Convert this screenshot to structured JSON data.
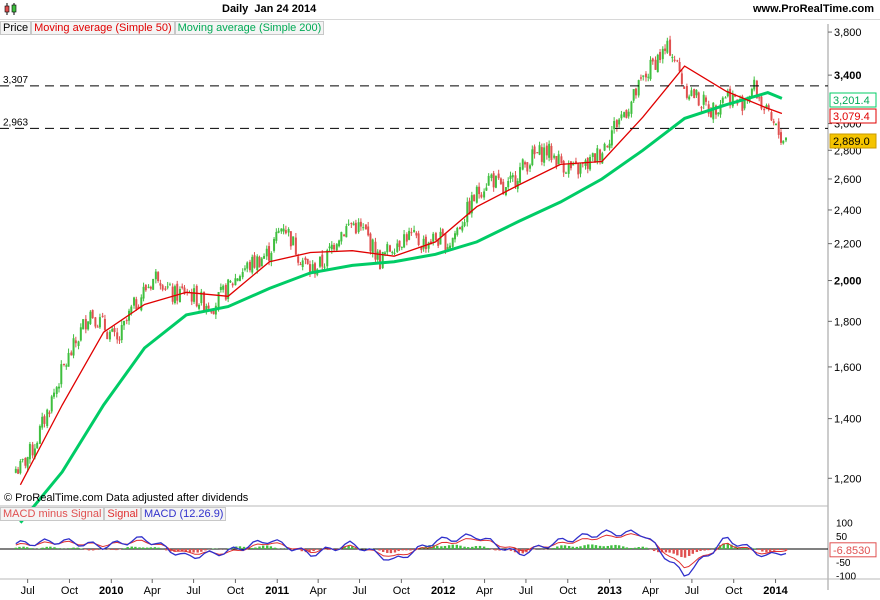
{
  "header": {
    "period": "Daily",
    "date": "Jan 24 2014",
    "brand": "www.ProRealTime.com"
  },
  "legend": {
    "price": "Price",
    "ma50": "Moving average (Simple 50)",
    "ma200": "Moving average (Simple 200)"
  },
  "watermark": "© ProRealTime.com  Data adjusted after dividends",
  "macd_legend": {
    "hist": "MACD minus Signal",
    "signal": "Signal",
    "macd": "MACD (12.26.9)"
  },
  "colors": {
    "up": "#3fbf3f",
    "down": "#e05050",
    "ma50": "#e00000",
    "ma200": "#00cc66",
    "macd": "#3030cc",
    "signal": "#e03030"
  },
  "chart_data": [
    {
      "type": "line",
      "title": "Daily  Jan 24 2014",
      "y_scale": "log",
      "ylim": [
        1120,
        3880
      ],
      "y_ticks": [
        "1,200",
        "1,400",
        "1,600",
        "1,800",
        "2,000",
        "2,200",
        "2,400",
        "2,600",
        "2,800",
        "3,000",
        "3,400",
        "3,800"
      ],
      "x_ticks": [
        "Jul",
        "Oct",
        "2010",
        "Apr",
        "Jul",
        "Oct",
        "2011",
        "Apr",
        "Jul",
        "Oct",
        "2012",
        "Apr",
        "Jul",
        "Oct",
        "2013",
        "Apr",
        "Jul",
        "Oct",
        "2014"
      ],
      "x_range": [
        "2009-06",
        "2014-01"
      ],
      "horizontal_lines": [
        {
          "label": "3,307",
          "value": 3307
        },
        {
          "label": "2,963",
          "value": 2963
        }
      ],
      "last_values": [
        {
          "label": "3,201.4",
          "value": 3201.4,
          "series": "Moving average (Simple 200)"
        },
        {
          "label": "3,079.4",
          "value": 3079.4,
          "series": "Moving average (Simple 50)"
        },
        {
          "label": "2,889.0",
          "value": 2889.0,
          "series": "Price"
        }
      ],
      "series": [
        {
          "name": "Price",
          "x": [
            "2009-06",
            "2009-07",
            "2009-08",
            "2009-09",
            "2009-10",
            "2009-11",
            "2009-12",
            "2010-01",
            "2010-02",
            "2010-03",
            "2010-04",
            "2010-05",
            "2010-06",
            "2010-07",
            "2010-08",
            "2010-09",
            "2010-10",
            "2010-11",
            "2010-12",
            "2011-01",
            "2011-02",
            "2011-03",
            "2011-04",
            "2011-05",
            "2011-06",
            "2011-07",
            "2011-08",
            "2011-09",
            "2011-10",
            "2011-11",
            "2011-12",
            "2012-01",
            "2012-02",
            "2012-03",
            "2012-04",
            "2012-05",
            "2012-06",
            "2012-07",
            "2012-08",
            "2012-09",
            "2012-10",
            "2012-11",
            "2012-12",
            "2013-01",
            "2013-02",
            "2013-03",
            "2013-04",
            "2013-05",
            "2013-06",
            "2013-07",
            "2013-08",
            "2013-09",
            "2013-10",
            "2013-11",
            "2013-12",
            "2014-01"
          ],
          "values": [
            1230,
            1300,
            1430,
            1580,
            1700,
            1850,
            1780,
            1700,
            1850,
            1950,
            2040,
            1920,
            1950,
            1900,
            1880,
            1960,
            2050,
            2100,
            2150,
            2320,
            2150,
            2050,
            2100,
            2250,
            2320,
            2260,
            2100,
            2200,
            2250,
            2200,
            2230,
            2200,
            2350,
            2500,
            2620,
            2500,
            2650,
            2750,
            2800,
            2720,
            2650,
            2700,
            2800,
            3000,
            3150,
            3350,
            3550,
            3650,
            3300,
            3200,
            3100,
            3250,
            3150,
            3300,
            3050,
            2889
          ]
        },
        {
          "name": "Moving average (Simple 50)",
          "x": [
            "2009-06",
            "2009-09",
            "2009-12",
            "2010-03",
            "2010-06",
            "2010-09",
            "2010-12",
            "2011-03",
            "2011-06",
            "2011-09",
            "2011-12",
            "2012-03",
            "2012-06",
            "2012-09",
            "2012-12",
            "2013-03",
            "2013-06",
            "2013-09",
            "2013-12",
            "2014-01"
          ],
          "values": [
            1180,
            1450,
            1750,
            1880,
            1940,
            1920,
            2100,
            2150,
            2160,
            2130,
            2210,
            2420,
            2560,
            2700,
            2720,
            3050,
            3480,
            3260,
            3120,
            3079.4
          ]
        },
        {
          "name": "Moving average (Simple 200)",
          "x": [
            "2009-06",
            "2009-09",
            "2009-12",
            "2010-03",
            "2010-06",
            "2010-09",
            "2010-12",
            "2011-03",
            "2011-06",
            "2011-09",
            "2011-12",
            "2012-03",
            "2012-06",
            "2012-09",
            "2012-12",
            "2013-03",
            "2013-06",
            "2013-09",
            "2013-12",
            "2014-01"
          ],
          "values": [
            1070,
            1220,
            1450,
            1680,
            1830,
            1870,
            1960,
            2040,
            2080,
            2100,
            2140,
            2210,
            2330,
            2450,
            2600,
            2800,
            3040,
            3150,
            3250,
            3201.4
          ]
        }
      ]
    },
    {
      "type": "line",
      "title": "MACD (12.26.9)",
      "ylim": [
        -110,
        110
      ],
      "y_ticks": [
        "100",
        "50",
        "-50",
        "-100"
      ],
      "last_values": [
        {
          "label": "-6.8530",
          "value": -6.853
        }
      ],
      "series": [
        {
          "name": "MACD (12.26.9)",
          "x": [
            "2009-06",
            "2009-09",
            "2009-12",
            "2010-03",
            "2010-06",
            "2010-09",
            "2010-12",
            "2011-03",
            "2011-06",
            "2011-09",
            "2011-12",
            "2012-03",
            "2012-06",
            "2012-09",
            "2012-12",
            "2013-03",
            "2013-06",
            "2013-09",
            "2013-12",
            "2014-01"
          ],
          "values": [
            20,
            30,
            10,
            40,
            -30,
            -10,
            35,
            -20,
            20,
            -45,
            30,
            50,
            -20,
            30,
            60,
            60,
            -100,
            40,
            -30,
            -10
          ]
        },
        {
          "name": "Signal",
          "x": [
            "2009-06",
            "2009-09",
            "2009-12",
            "2010-03",
            "2010-06",
            "2010-09",
            "2010-12",
            "2011-03",
            "2011-06",
            "2011-09",
            "2011-12",
            "2012-03",
            "2012-06",
            "2012-09",
            "2012-12",
            "2013-03",
            "2013-06",
            "2013-09",
            "2013-12",
            "2014-01"
          ],
          "values": [
            15,
            25,
            15,
            30,
            -15,
            -15,
            25,
            -10,
            10,
            -30,
            15,
            40,
            -5,
            20,
            45,
            55,
            -70,
            20,
            -20,
            -3
          ]
        },
        {
          "name": "MACD minus Signal",
          "x": [
            "2009-06",
            "2009-09",
            "2009-12",
            "2010-03",
            "2010-06",
            "2010-09",
            "2010-12",
            "2011-03",
            "2011-06",
            "2011-09",
            "2011-12",
            "2012-03",
            "2012-06",
            "2012-09",
            "2012-12",
            "2013-03",
            "2013-06",
            "2013-09",
            "2013-12",
            "2014-01"
          ],
          "values": [
            5,
            5,
            -5,
            10,
            -15,
            5,
            10,
            -10,
            10,
            -15,
            15,
            10,
            -15,
            10,
            15,
            5,
            -30,
            20,
            -10,
            -6.853
          ]
        }
      ]
    }
  ]
}
